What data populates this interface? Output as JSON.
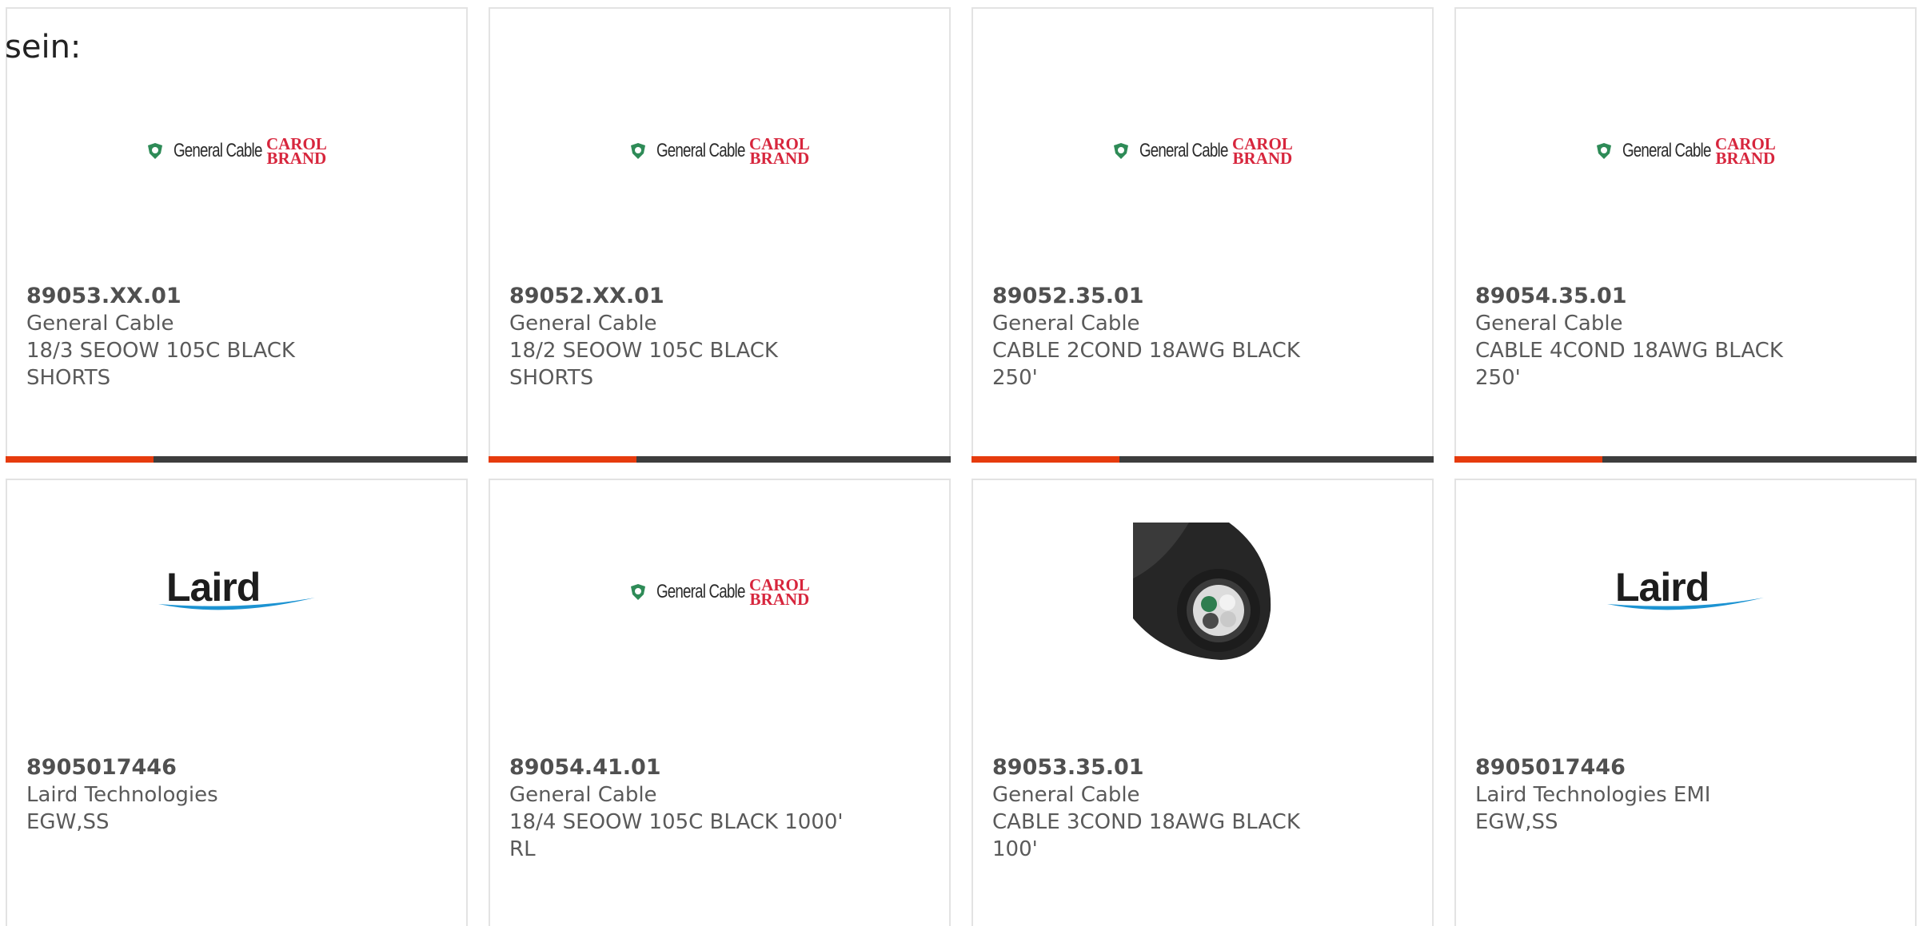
{
  "overlay_text": "sein:",
  "accent_color": "#e63b0d",
  "bar_color": "#3d3d3d",
  "products": [
    {
      "part_number": "89053.XX.01",
      "manufacturer": "General Cable",
      "description": "18/3 SEOOW 105C BLACK SHORTS",
      "logo": "general-cable-carol-brand-logo",
      "logo_text": "General Cable",
      "logo_brand_line1": "CAROL",
      "logo_brand_line2": "BRAND"
    },
    {
      "part_number": "89052.XX.01",
      "manufacturer": "General Cable",
      "description": "18/2 SEOOW 105C BLACK SHORTS",
      "logo": "general-cable-carol-brand-logo",
      "logo_text": "General Cable",
      "logo_brand_line1": "CAROL",
      "logo_brand_line2": "BRAND"
    },
    {
      "part_number": "89052.35.01",
      "manufacturer": "General Cable",
      "description": "CABLE 2COND 18AWG BLACK 250'",
      "logo": "general-cable-carol-brand-logo",
      "logo_text": "General Cable",
      "logo_brand_line1": "CAROL",
      "logo_brand_line2": "BRAND"
    },
    {
      "part_number": "89054.35.01",
      "manufacturer": "General Cable",
      "description": "CABLE 4COND 18AWG BLACK 250'",
      "logo": "general-cable-carol-brand-logo",
      "logo_text": "General Cable",
      "logo_brand_line1": "CAROL",
      "logo_brand_line2": "BRAND"
    },
    {
      "part_number": "8905017446",
      "manufacturer": "Laird Technologies",
      "description": "EGW,SS",
      "logo": "laird-logo",
      "logo_text": "Laird"
    },
    {
      "part_number": "89054.41.01",
      "manufacturer": "General Cable",
      "description": "18/4 SEOOW 105C BLACK 1000' RL",
      "logo": "general-cable-carol-brand-logo",
      "logo_text": "General Cable",
      "logo_brand_line1": "CAROL",
      "logo_brand_line2": "BRAND"
    },
    {
      "part_number": "89053.35.01",
      "manufacturer": "General Cable",
      "description": "CABLE 3COND 18AWG BLACK 100'",
      "logo": "cable-cross-section-image"
    },
    {
      "part_number": "8905017446",
      "manufacturer": "Laird Technologies EMI",
      "description": "EGW,SS",
      "logo": "laird-logo",
      "logo_text": "Laird"
    }
  ]
}
